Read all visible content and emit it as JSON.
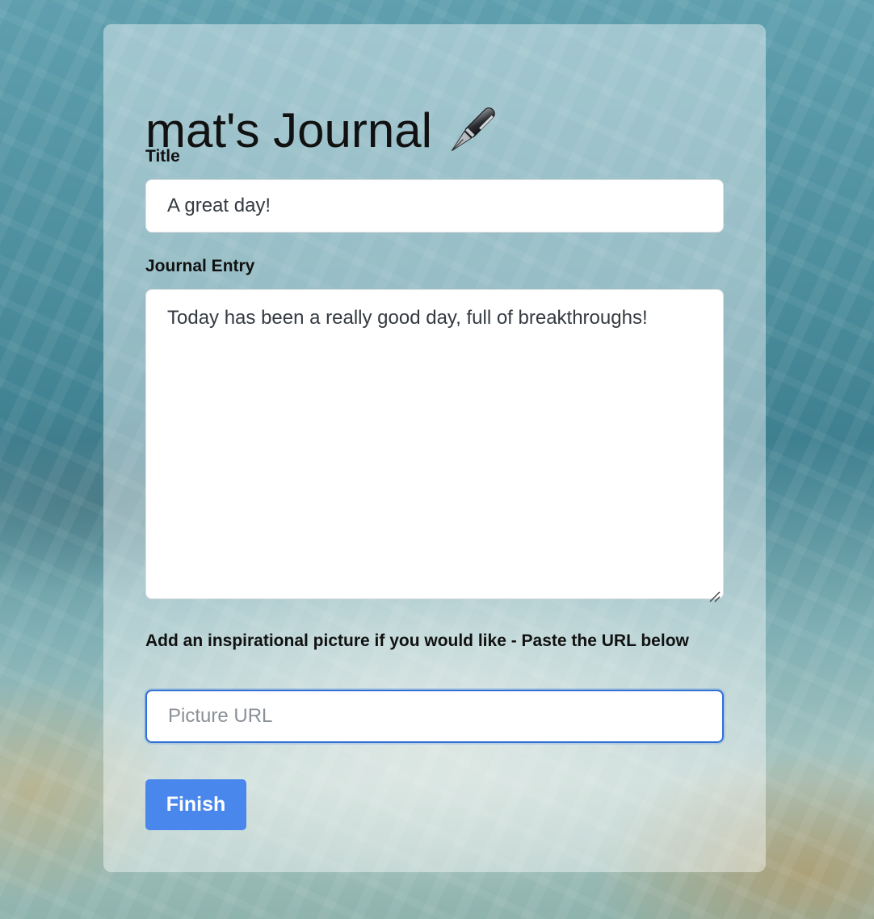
{
  "journal": {
    "title": "mat's Journal",
    "title_icon": "fountain-pen-icon"
  },
  "form": {
    "title_label": "Title",
    "title_value": "A great day!",
    "entry_label": "Journal Entry",
    "entry_value": "Today has been a really good day, full of breakthroughs!",
    "picture_label": "Add an inspirational picture if you would like - Paste the URL below",
    "picture_placeholder": "Picture URL",
    "picture_value": "",
    "finish_label": "Finish"
  },
  "colors": {
    "accent": "#4a87ec",
    "focus_ring": "#2f6fd6"
  }
}
